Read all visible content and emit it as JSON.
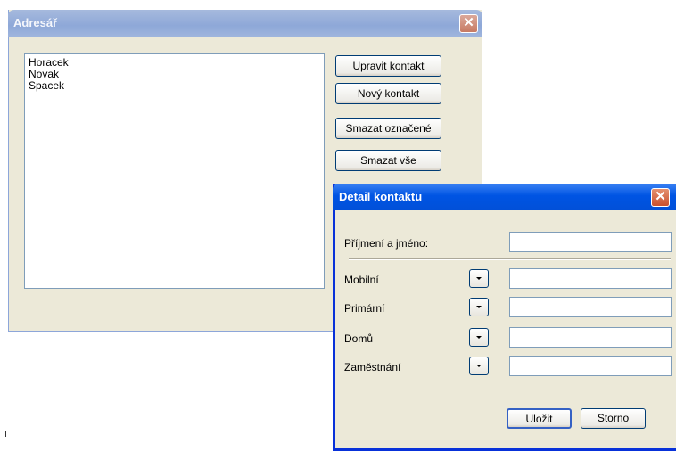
{
  "addressbook": {
    "title": "Adresář",
    "contacts": [
      "Horacek",
      "Novak",
      "Spacek"
    ],
    "buttons": {
      "edit": "Upravit kontakt",
      "new": "Nový kontakt",
      "delete_selected": "Smazat označené",
      "delete_all": "Smazat vše"
    }
  },
  "detail": {
    "title": "Detail kontaktu",
    "name_label": "Příjmení a jméno:",
    "name_value": "",
    "phones": [
      {
        "label": "Mobilní",
        "value": ""
      },
      {
        "label": "Primární",
        "value": ""
      },
      {
        "label": "Domů",
        "value": ""
      },
      {
        "label": "Zaměstnání",
        "value": ""
      }
    ],
    "save_label": "Uložit",
    "cancel_label": "Storno"
  },
  "icons": {
    "close": "close-icon",
    "dropdown": "chevron-down-icon"
  },
  "colors": {
    "active_title": "#0054e3",
    "inactive_title": "#9fb5dd",
    "close_button": "#c9502e",
    "window_bg": "#ece9d8"
  }
}
